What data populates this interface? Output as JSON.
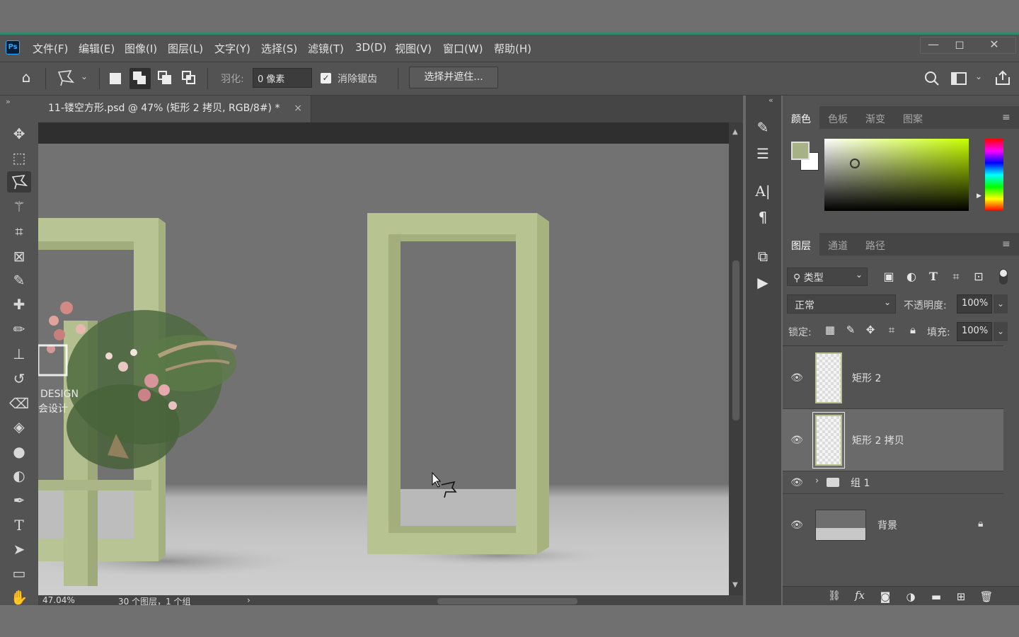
{
  "app": {
    "logo_text": "Ps",
    "menu": [
      "文件(F)",
      "编辑(E)",
      "图像(I)",
      "图层(L)",
      "文字(Y)",
      "选择(S)",
      "滤镜(T)",
      "3D(D)",
      "视图(V)",
      "窗口(W)",
      "帮助(H)"
    ],
    "window_controls": {
      "minimize": "—",
      "restore": "◻",
      "close": "✕"
    }
  },
  "options_bar": {
    "feather_label": "羽化:",
    "feather_value": "0 像素",
    "antialias_label": "消除锯齿",
    "antialias_checked": true,
    "select_mask_button": "选择并遮住..."
  },
  "document": {
    "tab_title": "11-镂空方形.psd @ 47% (矩形 2 拷贝, RGB/8#) *",
    "tab_close": "×",
    "canvas_logo_text_1": "DESIGN",
    "canvas_logo_text_2": "会设计"
  },
  "status_bar": {
    "zoom": "47.04%",
    "info": "30 个图层，1 个组"
  },
  "color_panel": {
    "tabs": [
      "颜色",
      "色板",
      "渐变",
      "图案"
    ],
    "active_tab": "颜色",
    "foreground_color": "#a6b285",
    "background_color": "#ffffff",
    "hue_color": "#c8ff00"
  },
  "layers_panel": {
    "tabs": [
      "图层",
      "通道",
      "路径"
    ],
    "active_tab": "图层",
    "filter_label": "类型",
    "blend_mode": "正常",
    "opacity_label": "不透明度:",
    "opacity_value": "100%",
    "lock_label": "锁定:",
    "fill_label": "填充:",
    "fill_value": "100%",
    "layers": [
      {
        "name": "矩形 2",
        "visible": true,
        "selected": false
      },
      {
        "name": "矩形 2 拷贝",
        "visible": true,
        "selected": true
      },
      {
        "name": "组 1",
        "visible": true,
        "selected": false,
        "type": "group"
      },
      {
        "name": "背景",
        "visible": true,
        "selected": false,
        "locked": true
      }
    ]
  },
  "colors": {
    "accent": "#2e8a6e",
    "frame_green": "#b7c28f",
    "frame_green_dark": "#9aa876",
    "panel_bg": "#535353"
  }
}
